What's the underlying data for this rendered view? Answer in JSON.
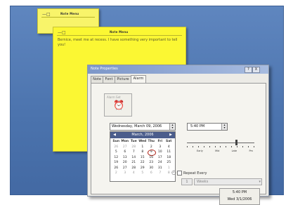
{
  "notes": {
    "small": {
      "title": "Note Menu"
    },
    "big": {
      "title": "Note Menu",
      "body": "Bernice, meet me at recess. I have something very important to tell you!"
    }
  },
  "dialog": {
    "title": "Note Properties",
    "close_label": "X",
    "help_label": "?",
    "tabs": [
      "Note",
      "Font",
      "Picture",
      "Alarm"
    ],
    "active_tab": "Alarm",
    "alarm_label": "Alarm Set",
    "date_value": "Wednesday, March 09, 2006",
    "time_value": "5:40 PM",
    "calendar": {
      "month_label": "March, 2006",
      "day_headers": [
        "Sun",
        "Mon",
        "Tue",
        "Wed",
        "Thu",
        "Fri",
        "Sat"
      ],
      "weeks": [
        [
          "26",
          "27",
          "28",
          "1",
          "2",
          "3",
          "4"
        ],
        [
          "5",
          "6",
          "7",
          "8",
          "9",
          "10",
          "11"
        ],
        [
          "12",
          "13",
          "14",
          "15",
          "16",
          "17",
          "18"
        ],
        [
          "19",
          "20",
          "21",
          "22",
          "23",
          "24",
          "25"
        ],
        [
          "26",
          "27",
          "28",
          "29",
          "30",
          "31",
          "1"
        ],
        [
          "2",
          "3",
          "4",
          "5",
          "6",
          "7",
          "8"
        ]
      ],
      "selected_day": "9"
    },
    "slider_labels": [
      "Early",
      "Mid",
      "Late",
      "Pm"
    ],
    "repeat_label": "Repeat Every",
    "repeat_count": "1",
    "repeat_unit": "Weeks",
    "summary_time": "5:40 PM",
    "summary_date": "Wed 3/1/2006"
  },
  "colors": {
    "desktop": "#5479b3",
    "note": "#fbf733",
    "titlebar": "#7d97c9",
    "calendar_header": "#4b5d8c"
  }
}
